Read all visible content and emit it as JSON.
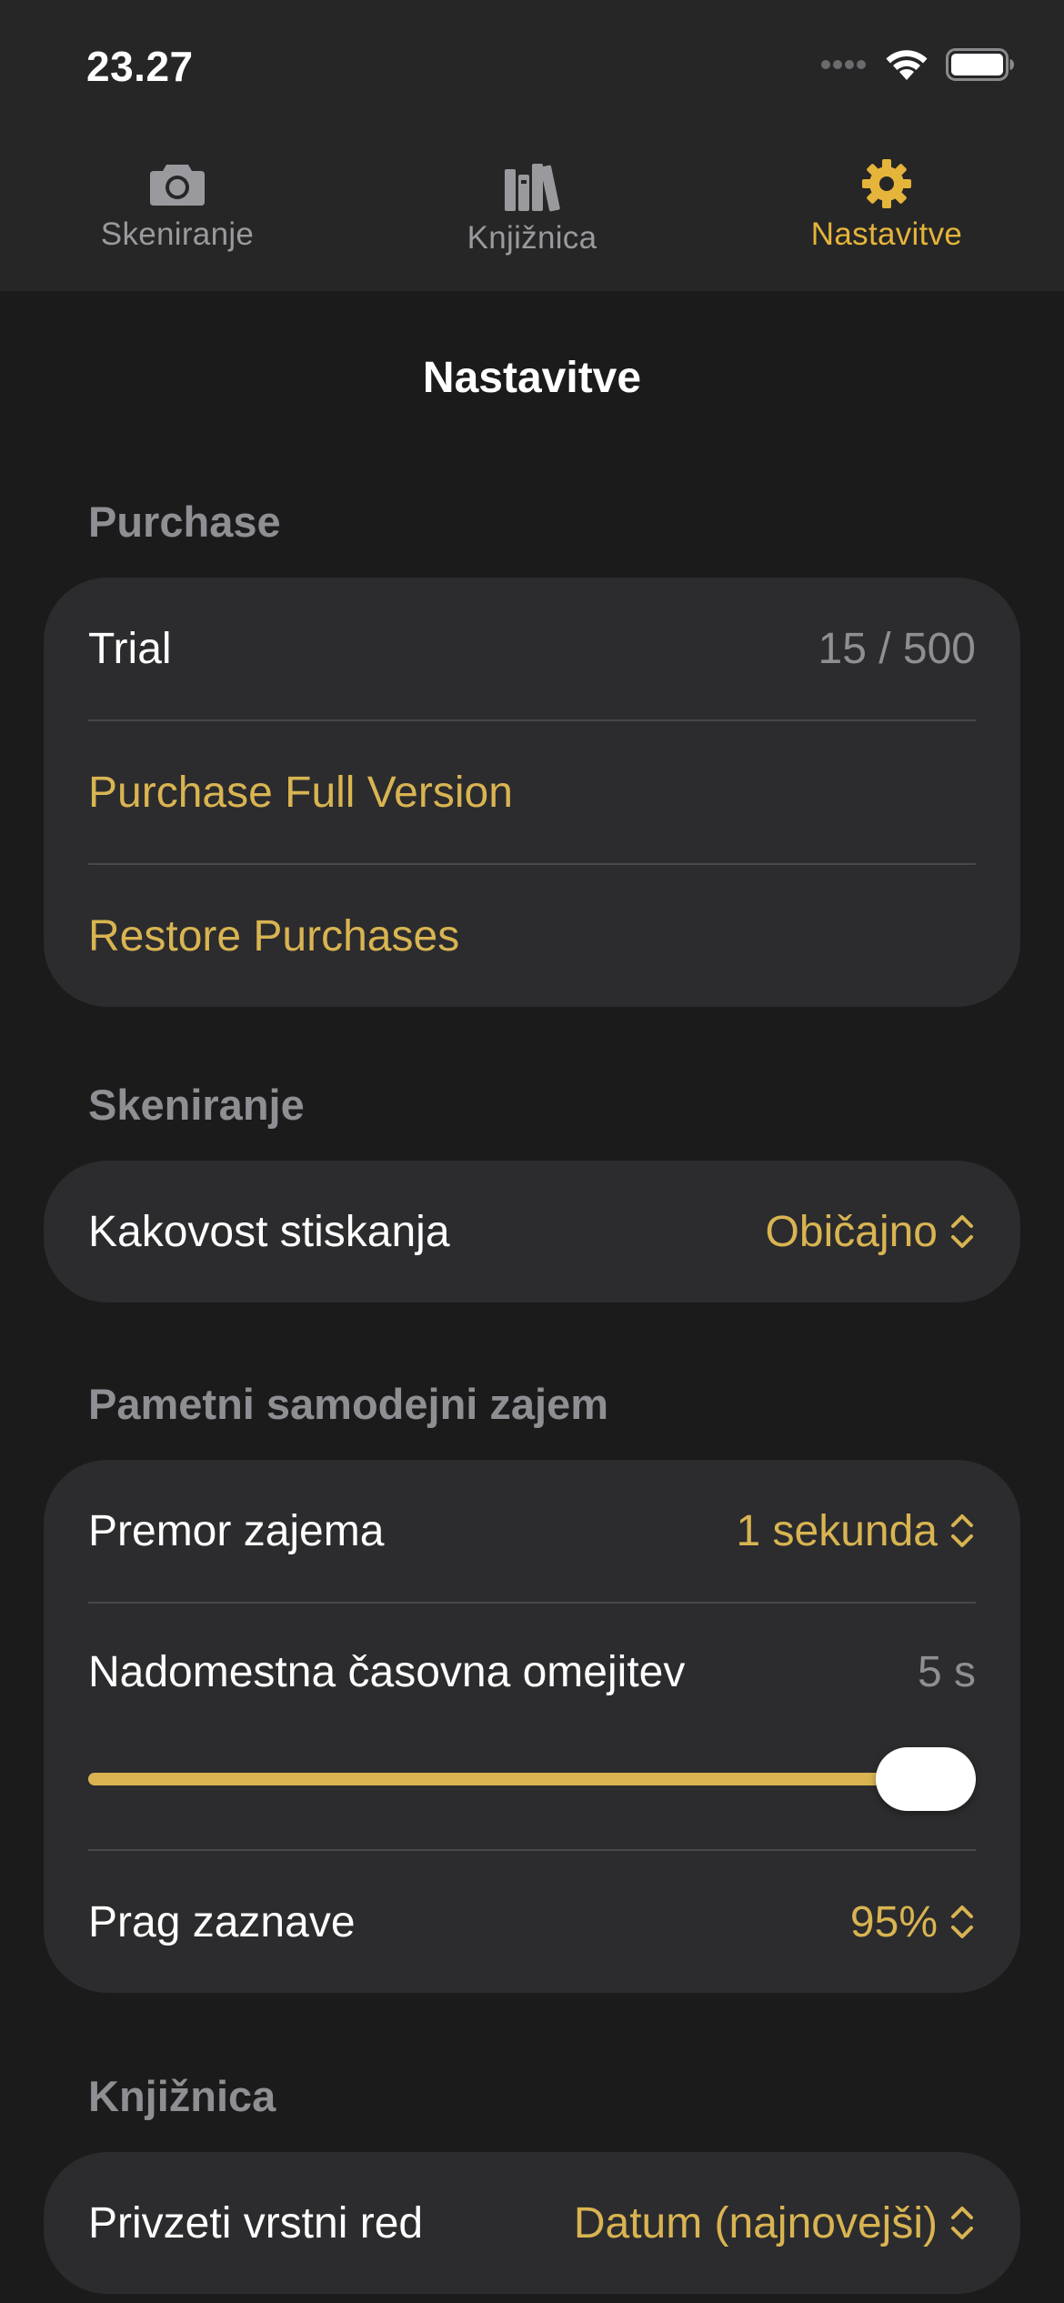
{
  "status_bar": {
    "time": "23.27"
  },
  "tabs": [
    {
      "label": "Skeniranje",
      "icon": "camera-icon",
      "active": false
    },
    {
      "label": "Knjižnica",
      "icon": "books-icon",
      "active": false
    },
    {
      "label": "Nastavitve",
      "icon": "gear-icon",
      "active": true
    }
  ],
  "nav": {
    "title": "Nastavitve"
  },
  "sections": {
    "purchase": {
      "header": "Purchase",
      "trial_label": "Trial",
      "trial_value": "15 / 500",
      "purchase_full": "Purchase Full Version",
      "restore": "Restore Purchases"
    },
    "scanning": {
      "header": "Skeniranje",
      "compression_label": "Kakovost stiskanja",
      "compression_value": "Običajno"
    },
    "smart_capture": {
      "header": "Pametni samodejni zajem",
      "pause_label": "Premor zajema",
      "pause_value": "1 sekunda",
      "timeout_label": "Nadomestna časovna omejitev",
      "timeout_value": "5 s",
      "timeout_slider_fraction": 1.0,
      "threshold_label": "Prag zaznave",
      "threshold_value": "95%"
    },
    "library": {
      "header": "Knjižnica",
      "sort_label": "Privzeti vrstni red",
      "sort_value": "Datum (najnovejši)"
    }
  },
  "colors": {
    "accent": "#e5b43a",
    "accent_text": "#d9b451",
    "background": "#1b1b1b",
    "group_background": "#2c2c2e",
    "secondary_text": "#8e8e93"
  }
}
